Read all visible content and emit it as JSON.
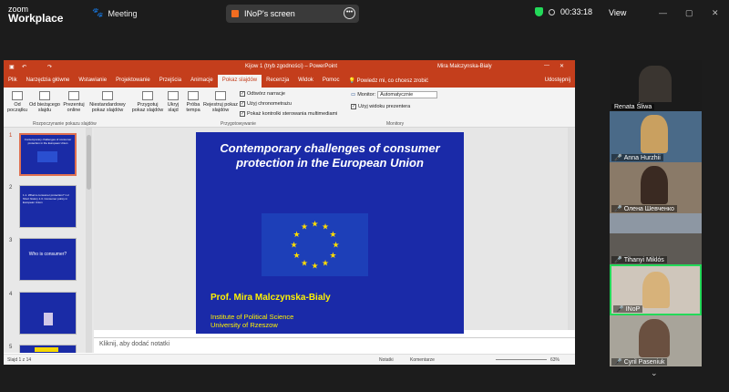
{
  "zoom": {
    "logo_top": "zoom",
    "logo_bottom": "Workplace",
    "meeting_label": "Meeting",
    "share_label": "INoP's screen",
    "timer": "00:33:18",
    "view_label": "View"
  },
  "ppt": {
    "doc_title": "Kijow 1 (tryb zgodności)  –  PowerPoint",
    "user": "Mira Malczynska-Bialy",
    "tabs": [
      "Plik",
      "Narzędzia główne",
      "Wstawianie",
      "Projektowanie",
      "Przejścia",
      "Animacje",
      "Pokaz slajdów",
      "Recenzja",
      "Widok",
      "Pomoc"
    ],
    "tell_me": "Powiedz mi, co chcesz zrobić",
    "share": "Udostępnij",
    "ribbon": {
      "b1": "Od początku",
      "b2": "Od bieżącego slajdu",
      "b3": "Prezentuj online",
      "b4": "Niestandardowy pokaz slajdów",
      "b5": "Przygotuj pokaz slajdów",
      "b6": "Ukryj slajd",
      "b7": "Próba tempa",
      "b8": "Rejestruj pokaz slajdów",
      "c1": "Odtwórz narracje",
      "c2": "Użyj chronometrażu",
      "c3": "Pokaż kontrolki sterowania multimediami",
      "monitor_label": "Monitor:",
      "monitor_value": "Automatycznie",
      "presenter": "Użyj widoku prezentera",
      "g1": "Rozpoczynanie pokazu slajdów",
      "g2": "Przygotowywanie",
      "g3": "Monitory"
    },
    "thumbs": [
      {
        "num": "1",
        "text": "Contemporary challenges of consumer protection in the European Union"
      },
      {
        "num": "2",
        "text": "1.1. What is consumer protection? 1.2. Short history 1.3. Consumer policy in European Union"
      },
      {
        "num": "3",
        "text": "Who is consumer?"
      },
      {
        "num": "4",
        "text": ""
      },
      {
        "num": "5",
        "text": ""
      }
    ],
    "slide": {
      "title": "Contemporary challenges of consumer protection in the European Union",
      "author": "Prof. Mira Malczynska-Bialy",
      "inst1": "Institute of Political Science",
      "inst2": "University of Rzeszow"
    },
    "notes_placeholder": "Kliknij, aby dodać notatki",
    "status": {
      "slide": "Slajd 1 z 14",
      "notes": "Notatki",
      "comments": "Komentarze",
      "zoom": "63%"
    }
  },
  "participants": [
    {
      "name": "Renata Śliwa",
      "muted": false
    },
    {
      "name": "Anna Hurzhii",
      "muted": true
    },
    {
      "name": "Олена Шевченко",
      "muted": true
    },
    {
      "name": "Tihanyi Miklós",
      "muted": true
    },
    {
      "name": "INoP",
      "muted": true
    },
    {
      "name": "Cyril Paseniuk",
      "muted": true
    }
  ],
  "colors": {
    "ppt_accent": "#c43e1c",
    "slide_bg": "#1a2aa8",
    "active_speaker": "#23d959"
  }
}
